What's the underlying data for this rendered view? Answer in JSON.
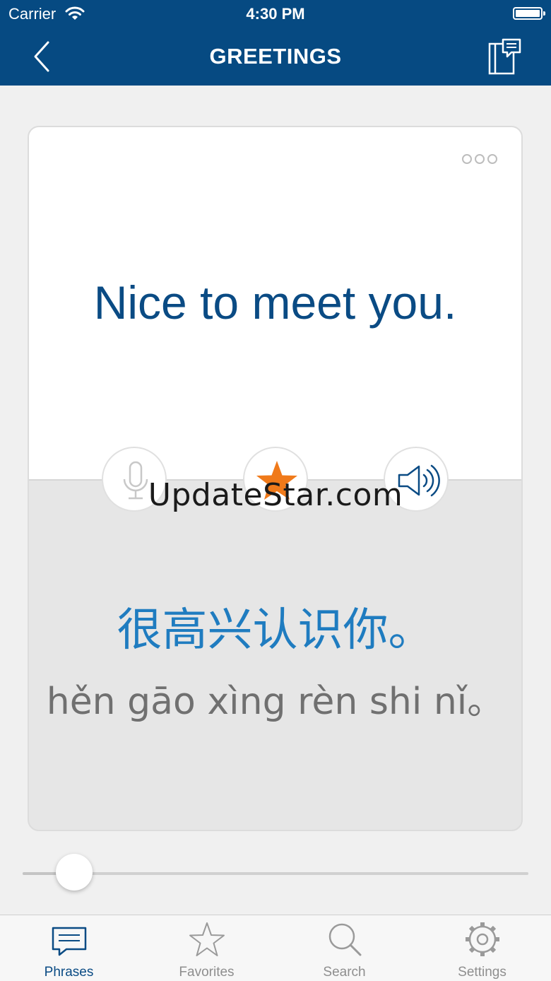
{
  "status_bar": {
    "carrier": "Carrier",
    "time": "4:30 PM"
  },
  "nav": {
    "title": "GREETINGS"
  },
  "card": {
    "phrase": "Nice to meet you.",
    "translation_native": "很高兴认识你。",
    "translation_romanized": "hěn gāo xìng rèn shi nǐ。"
  },
  "watermark": "UpdateStar.com",
  "slider": {
    "value": 0.04
  },
  "tabs": [
    {
      "label": "Phrases",
      "icon": "speech-bubble-icon",
      "active": true
    },
    {
      "label": "Favorites",
      "icon": "star-icon",
      "active": false
    },
    {
      "label": "Search",
      "icon": "magnifier-icon",
      "active": false
    },
    {
      "label": "Settings",
      "icon": "gear-icon",
      "active": false
    }
  ],
  "colors": {
    "brand": "#064a82",
    "phrase": "#0a4b84",
    "translation": "#1f7cc0",
    "favorite": "#f07a1a"
  }
}
